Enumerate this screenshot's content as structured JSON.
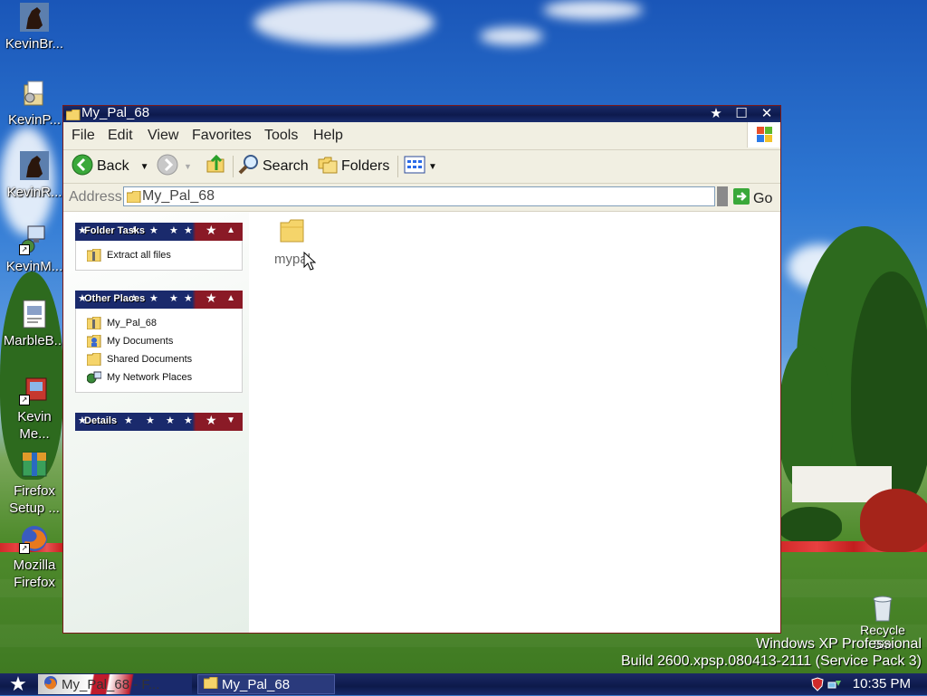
{
  "desktop": {
    "icons": [
      {
        "name": "KevinBr...",
        "icon": "horse-icon"
      },
      {
        "name": "KevinP...",
        "icon": "setup-package-icon"
      },
      {
        "name": "KevinR...",
        "icon": "horse-icon"
      },
      {
        "name": "KevinM...",
        "icon": "network-computer-icon"
      },
      {
        "name": "MarbleB...",
        "icon": "document-icon"
      },
      {
        "name": "Kevin\nMe...",
        "icon": "media-shortcut-icon"
      },
      {
        "name": "Firefox\nSetup ...",
        "icon": "firefox-setup-icon"
      },
      {
        "name": "Mozilla\nFirefox",
        "icon": "firefox-icon"
      }
    ],
    "recycle_bin": "Recycle\nBin",
    "watermark_line1": "Windows XP Professional",
    "watermark_line2": "Build 2600.xpsp.080413-2111 (Service Pack 3)"
  },
  "window": {
    "title": "My_Pal_68",
    "menu": [
      "File",
      "Edit",
      "View",
      "Favorites",
      "Tools",
      "Help"
    ],
    "toolbar": {
      "back": "Back",
      "search": "Search",
      "folders": "Folders"
    },
    "address": {
      "label": "Address",
      "value": "My_Pal_68",
      "go": "Go"
    },
    "task_pane": {
      "folder_tasks": {
        "title": "Folder Tasks",
        "items": [
          "Extract all files"
        ]
      },
      "other_places": {
        "title": "Other Places",
        "items": [
          "My_Pal_68",
          "My Documents",
          "Shared Documents",
          "My Network Places"
        ]
      },
      "details": {
        "title": "Details"
      }
    },
    "content": {
      "items": [
        {
          "name": "mypal",
          "icon": "folder-icon"
        }
      ]
    }
  },
  "taskbar": {
    "buttons": [
      {
        "label": "My_Pal_68 - F...",
        "icon": "firefox-icon"
      },
      {
        "label": "My_Pal_68",
        "icon": "folder-icon"
      }
    ],
    "clock": "10:35 PM"
  },
  "colors": {
    "titlebar": "#0d1a4d",
    "panel_blue": "#1a2a6c",
    "panel_red": "#8a1a26",
    "menubar": "#f1efe2"
  }
}
